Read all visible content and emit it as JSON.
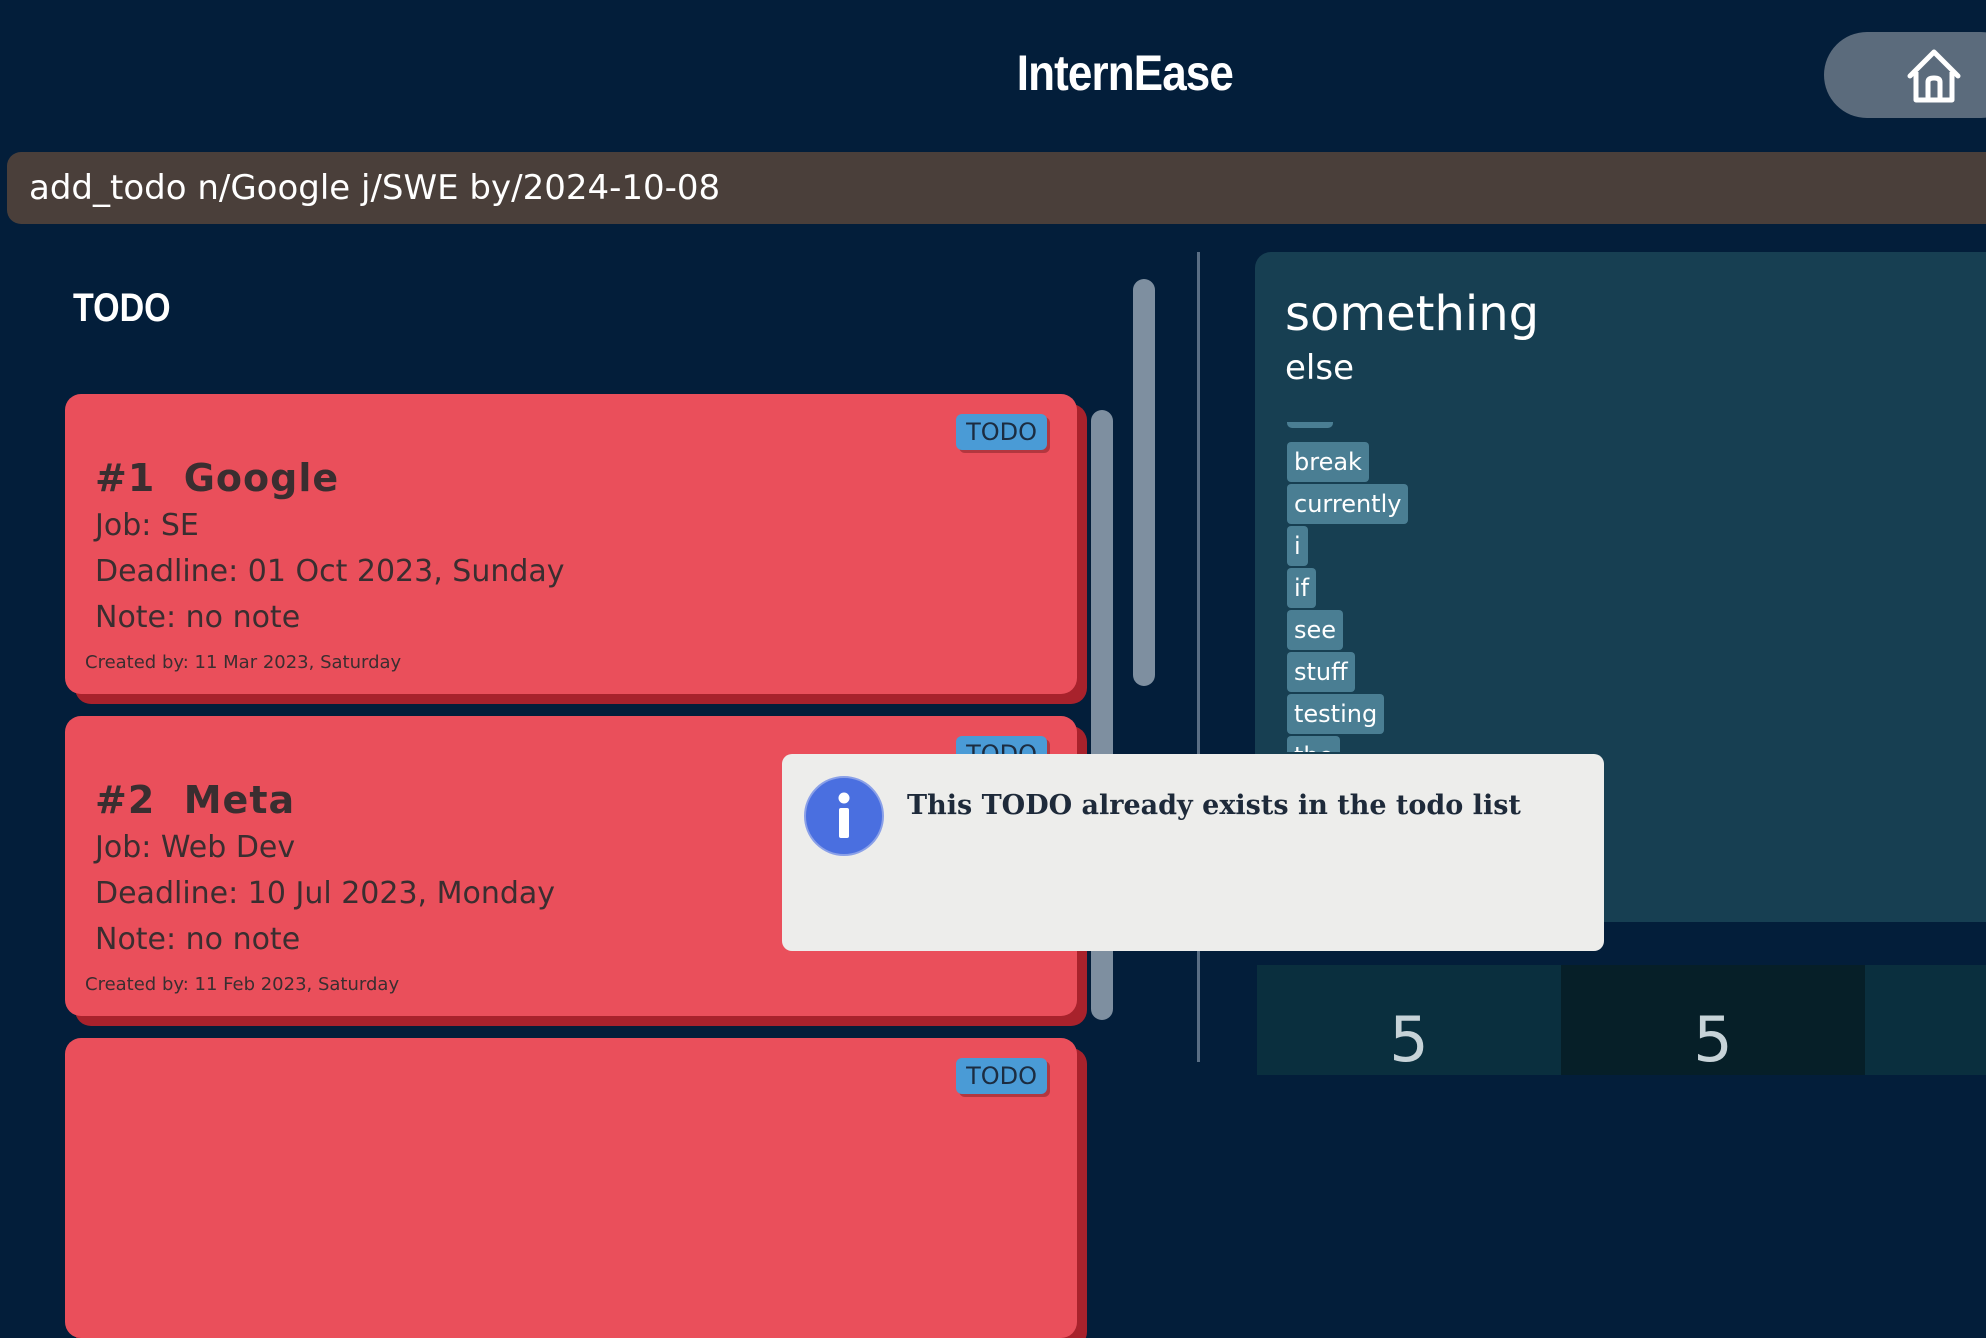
{
  "header": {
    "title": "InternEase"
  },
  "command": {
    "value": "add_todo n/Google j/SWE by/2024-10-08"
  },
  "todo_panel": {
    "title": "TODO",
    "cards": [
      {
        "badge": "TODO",
        "title": "#1  Google",
        "job": "Job: SE",
        "deadline": "Deadline: 01 Oct 2023, Sunday",
        "note": "Note: no note",
        "created": "Created by: 11 Mar 2023, Saturday"
      },
      {
        "badge": "TODO",
        "title": "#2  Meta",
        "job": "Job: Web Dev",
        "deadline": "Deadline: 10 Jul 2023, Monday",
        "note": "Note: no note",
        "created": "Created by: 11 Feb 2023, Saturday"
      },
      {
        "badge": "TODO"
      }
    ]
  },
  "detail_panel": {
    "title": "something",
    "subtitle": "else",
    "tags": [
      "break",
      "currently",
      "i",
      "if",
      "see",
      "stuff",
      "testing",
      "the"
    ]
  },
  "stats": [
    "5",
    "5"
  ],
  "popup": {
    "message": "This TODO already exists in the todo list",
    "icon": "info-icon"
  },
  "colors": {
    "background": "#031e3a",
    "card": "#ea4f5b",
    "badge": "#4a9bd6",
    "command_box": "#4a3f3a",
    "detail_panel": "#173f52",
    "info_icon": "#4a6fe0"
  }
}
